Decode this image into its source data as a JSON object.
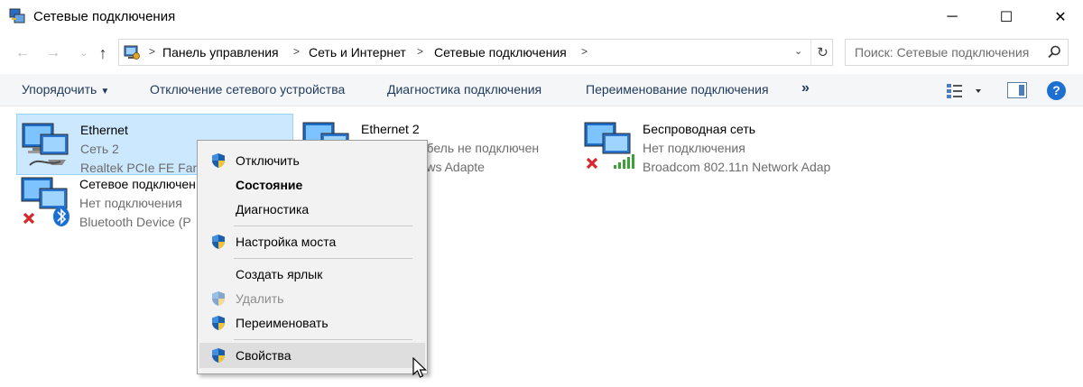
{
  "window": {
    "title": "Сетевые подключения",
    "minimize": "─",
    "maximize": "☐",
    "close": "✕"
  },
  "nav": {
    "back": "←",
    "forward": "→",
    "recent": "⌄",
    "up": "↑"
  },
  "address": {
    "breadcrumbs": [
      "Панель управления",
      "Сеть и Интернет",
      "Сетевые подключения"
    ],
    "separator": ">",
    "refresh": "↻",
    "dropdown": "⌄"
  },
  "search": {
    "placeholder": "Поиск: Сетевые подключения"
  },
  "toolbar": {
    "organize": "Упорядочить",
    "disable_device": "Отключение сетевого устройства",
    "diagnose": "Диагностика подключения",
    "rename": "Переименование подключения",
    "more": "»",
    "help": "?"
  },
  "connections": [
    {
      "name": "Ethernet",
      "network": "Сеть 2",
      "adapter": "Realtek PCIe FE Fam",
      "status": "connected",
      "selected": true
    },
    {
      "name": "Ethernet 2",
      "network": "Сетевой кабель не подключен",
      "adapter": "VPN Windows Adapte",
      "status": "cable-unplugged",
      "selected": false
    },
    {
      "name": "Беспроводная сеть",
      "network": "Нет подключения",
      "adapter": "Broadcom 802.11n Network Adap",
      "status": "disconnected",
      "selected": false
    },
    {
      "name": "Сетевое подключен",
      "network": "Нет подключения",
      "adapter": "Bluetooth Device (P",
      "status": "disconnected",
      "selected": false
    }
  ],
  "context_menu": {
    "items": [
      {
        "label": "Отключить",
        "shield": true,
        "bold": false,
        "disabled": false
      },
      {
        "label": "Состояние",
        "shield": false,
        "bold": true,
        "disabled": false
      },
      {
        "label": "Диагностика",
        "shield": false,
        "bold": false,
        "disabled": false
      },
      {
        "label": "Настройка моста",
        "shield": true,
        "bold": false,
        "disabled": false
      },
      {
        "label": "Создать ярлык",
        "shield": false,
        "bold": false,
        "disabled": false
      },
      {
        "label": "Удалить",
        "shield": true,
        "bold": false,
        "disabled": true
      },
      {
        "label": "Переименовать",
        "shield": true,
        "bold": false,
        "disabled": false
      },
      {
        "label": "Свойства",
        "shield": true,
        "bold": false,
        "disabled": false,
        "hovered": true
      }
    ]
  },
  "colors": {
    "selection_bg": "#cce8ff",
    "selection_border": "#99d1ff",
    "link_text": "#1e395b",
    "secondary_text": "#6d6d6d",
    "help_blue": "#1d6fd1",
    "error_red": "#d8262b",
    "signal_green": "#3aa335",
    "bluetooth_blue": "#1b6fd3"
  }
}
